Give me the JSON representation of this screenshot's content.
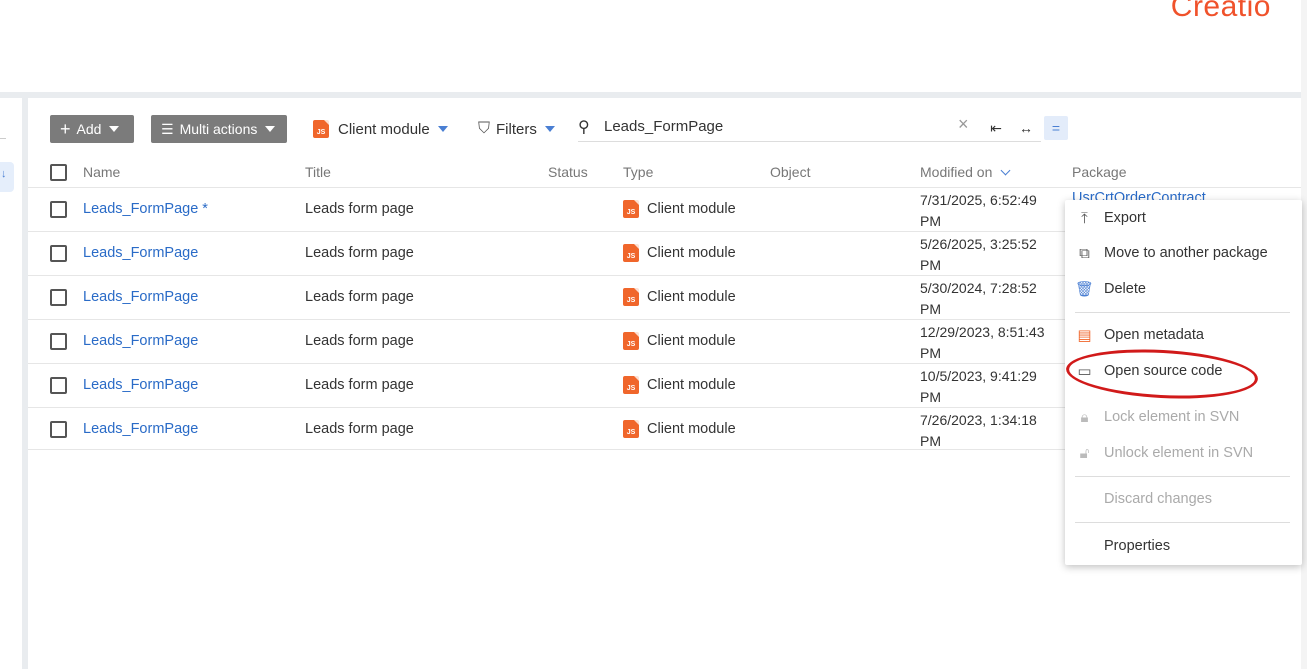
{
  "brand": "Creatio",
  "toolbar": {
    "add_label": "Add",
    "multi_actions_label": "Multi actions",
    "module_filter_label": "Client module",
    "filters_label": "Filters",
    "search_value": "Leads_FormPage"
  },
  "columns": {
    "name": "Name",
    "title": "Title",
    "status": "Status",
    "type": "Type",
    "object": "Object",
    "modified_on": "Modified on",
    "package": "Package"
  },
  "rows": [
    {
      "name": "Leads_FormPage *",
      "title": "Leads form page",
      "type": "Client module",
      "modified_line1": "7/31/2025, 6:52:49",
      "modified_line2": "PM",
      "package": "UsrCrtOrderContract"
    },
    {
      "name": "Leads_FormPage",
      "title": "Leads form page",
      "type": "Client module",
      "modified_line1": "5/26/2025, 3:25:52",
      "modified_line2": "PM"
    },
    {
      "name": "Leads_FormPage",
      "title": "Leads form page",
      "type": "Client module",
      "modified_line1": "5/30/2024, 7:28:52",
      "modified_line2": "PM"
    },
    {
      "name": "Leads_FormPage",
      "title": "Leads form page",
      "type": "Client module",
      "modified_line1": "12/29/2023, 8:51:43",
      "modified_line2": "PM"
    },
    {
      "name": "Leads_FormPage",
      "title": "Leads form page",
      "type": "Client module",
      "modified_line1": "10/5/2023, 9:41:29",
      "modified_line2": "PM"
    },
    {
      "name": "Leads_FormPage",
      "title": "Leads form page",
      "type": "Client module",
      "modified_line1": "7/26/2023, 1:34:18",
      "modified_line2": "PM"
    }
  ],
  "type_icon_text": "JS",
  "context_menu": {
    "export": "Export",
    "move": "Move to another package",
    "delete": "Delete",
    "open_metadata": "Open metadata",
    "open_source": "Open source code",
    "lock": "Lock element in SVN",
    "unlock": "Unlock element in SVN",
    "discard": "Discard changes",
    "properties": "Properties"
  },
  "colors": {
    "link": "#2a6bc7",
    "brand": "#f0522b",
    "js_icon": "#f0662b",
    "annotation": "#d11a1a"
  }
}
